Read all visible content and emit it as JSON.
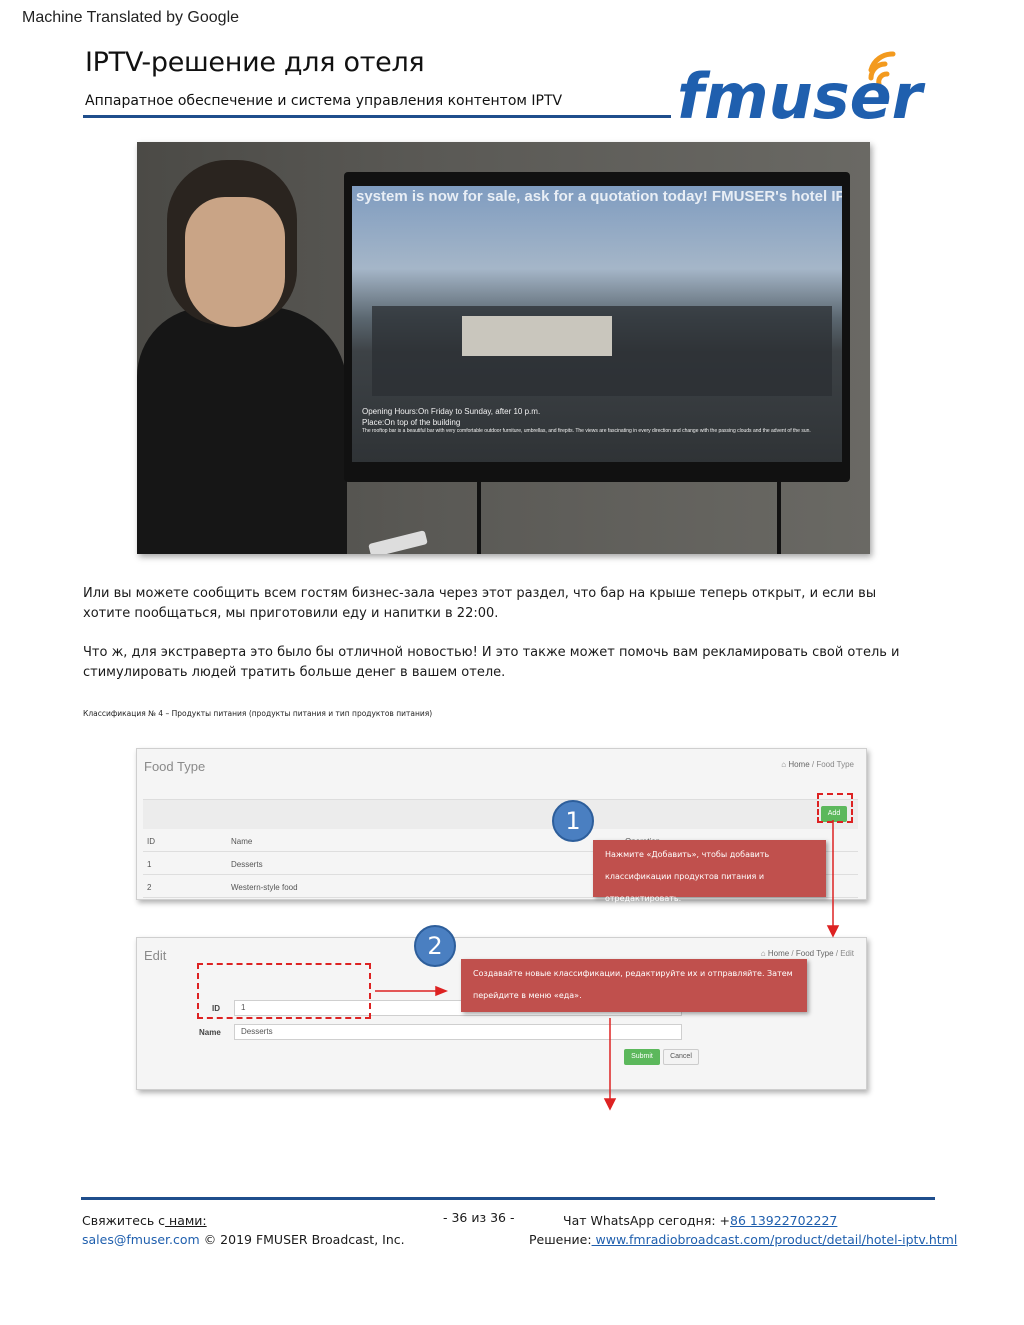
{
  "banner": {
    "machine_translated": "Machine Translated by Google"
  },
  "header": {
    "title": "IPTV-решение для отеля",
    "subtitle": "Аппаратное обеспечение и система управления контентом IPTV",
    "logo_text": "fmuser"
  },
  "photo": {
    "tv_ticker": "system is now for sale, ask for a quotation today! FMUSER's hotel IPTV",
    "tv_line1": "Opening Hours:On Friday to Sunday, after 10 p.m.",
    "tv_line2": "Place:On top of the building",
    "tv_line3": "The rooftop bar is a beautiful bar with very comfortable outdoor furniture, umbrellas, and firepits. The views are fascinating in every direction and change with the passing clouds and the advent of the sun."
  },
  "body": {
    "para1": "Или вы можете сообщить всем гостям бизнес-зала через этот раздел, что бар на крыше теперь открыт, и если вы хотите пообщаться, мы приготовили еду и напитки в 22:00.",
    "para2": "Что ж, для экстраверта это было бы отличной новостью! И это также может помочь вам рекламировать свой отель и стимулировать людей тратить больше денег в вашем отеле.",
    "caption": "Классификация № 4 – Продукты питания (продукты питания и тип продуктов питания)"
  },
  "panel1": {
    "title": "Food Type",
    "breadcrumb_home": "Home",
    "breadcrumb_current": "Food Type",
    "add_label": "Add",
    "columns": {
      "id": "ID",
      "name": "Name",
      "operation": "Operation"
    },
    "rows": [
      {
        "id": "1",
        "name": "Desserts"
      },
      {
        "id": "2",
        "name": "Western-style food"
      }
    ]
  },
  "panel2": {
    "title": "Edit",
    "breadcrumb_home": "Home",
    "breadcrumb_mid": "Food Type",
    "breadcrumb_current": "Edit",
    "id_label": "ID",
    "id_value": "1",
    "name_label": "Name",
    "name_value": "Desserts",
    "submit_label": "Submit",
    "cancel_label": "Cancel"
  },
  "annotations": {
    "step1_number": "1",
    "step1_line1": "Нажмите «Добавить», чтобы добавить",
    "step1_line2": "классификации продуктов питания и отредактировать.",
    "step2_number": "2",
    "step2_line1": "Создавайте новые классификации, редактируйте их и отправляйте. Затем",
    "step2_line2": "перейдите в меню «еда»."
  },
  "footer": {
    "contact_prefix": "Свяжитесь с",
    "contact_link": " нами:",
    "email": "sales@fmuser.com",
    "copyright": " © 2019 FMUSER Broadcast, Inc.",
    "page_number": "- 36 из 36 -",
    "whatsapp_label": "Чат WhatsApp сегодня: +",
    "whatsapp_number": "86 13922702227",
    "solution_label": "Решение:",
    "solution_url": " www.fmradiobroadcast.com/product/detail/hotel-iptv.html"
  },
  "colors": {
    "brand_blue": "#1f4e8c",
    "logo_orange": "#f39a1e",
    "note_red": "#c0504d",
    "button_green": "#5cb85c",
    "link_blue": "#1f5fae"
  }
}
